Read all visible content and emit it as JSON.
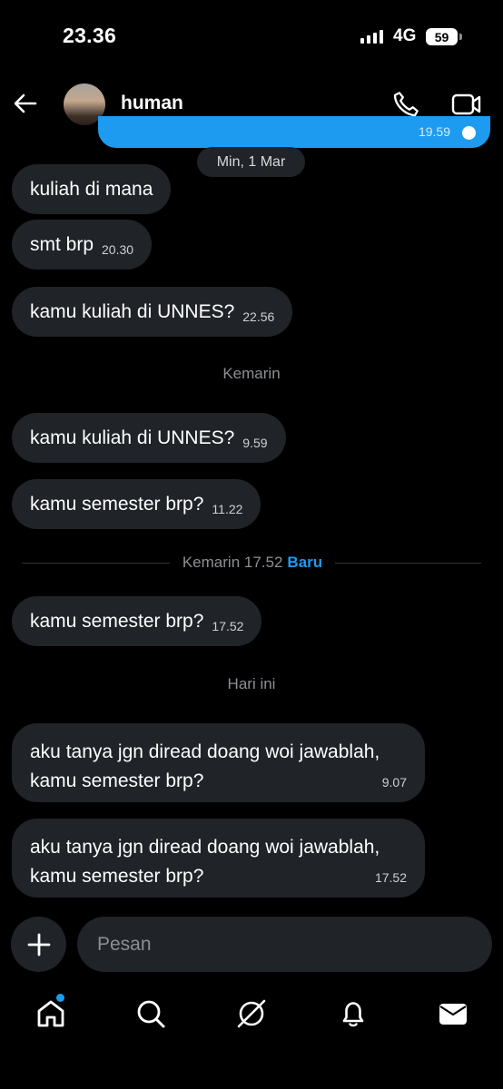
{
  "status_bar": {
    "time": "23.36",
    "network": "4G",
    "battery": "59"
  },
  "header": {
    "contact_name": "human",
    "icons": [
      "back-arrow-icon",
      "avatar",
      "phone-icon",
      "video-icon"
    ]
  },
  "previous_sent": {
    "time": "19.59"
  },
  "date_divider": "Min, 1 Mar",
  "messages_group_1": [
    {
      "text": "kuliah di mana",
      "time": ""
    },
    {
      "text": "smt brp",
      "time": "20.30"
    },
    {
      "text": "kamu kuliah di UNNES?",
      "time": "22.56"
    }
  ],
  "separator_yesterday": "Kemarin",
  "messages_group_2": [
    {
      "text": "kamu kuliah di UNNES?",
      "time": "9.59"
    },
    {
      "text": "kamu semester brp?",
      "time": "11.22"
    }
  ],
  "new_divider": {
    "label": "Kemarin 17.52",
    "badge": "Baru"
  },
  "messages_group_3": [
    {
      "text": "kamu semester brp?",
      "time": "17.52"
    }
  ],
  "separator_today": "Hari ini",
  "messages_group_4": [
    {
      "text": "aku tanya jgn diread doang woi jawablah,\nkamu semester brp?",
      "time": "9.07"
    },
    {
      "text": "aku tanya jgn diread doang woi jawablah,\nkamu semester brp?",
      "time": "17.52"
    }
  ],
  "composer": {
    "placeholder": "Pesan"
  },
  "bottom_nav": {
    "items": [
      "home-icon",
      "search-icon",
      "grok-icon",
      "notifications-icon",
      "messages-icon"
    ],
    "accent": "#1d9bf0"
  }
}
